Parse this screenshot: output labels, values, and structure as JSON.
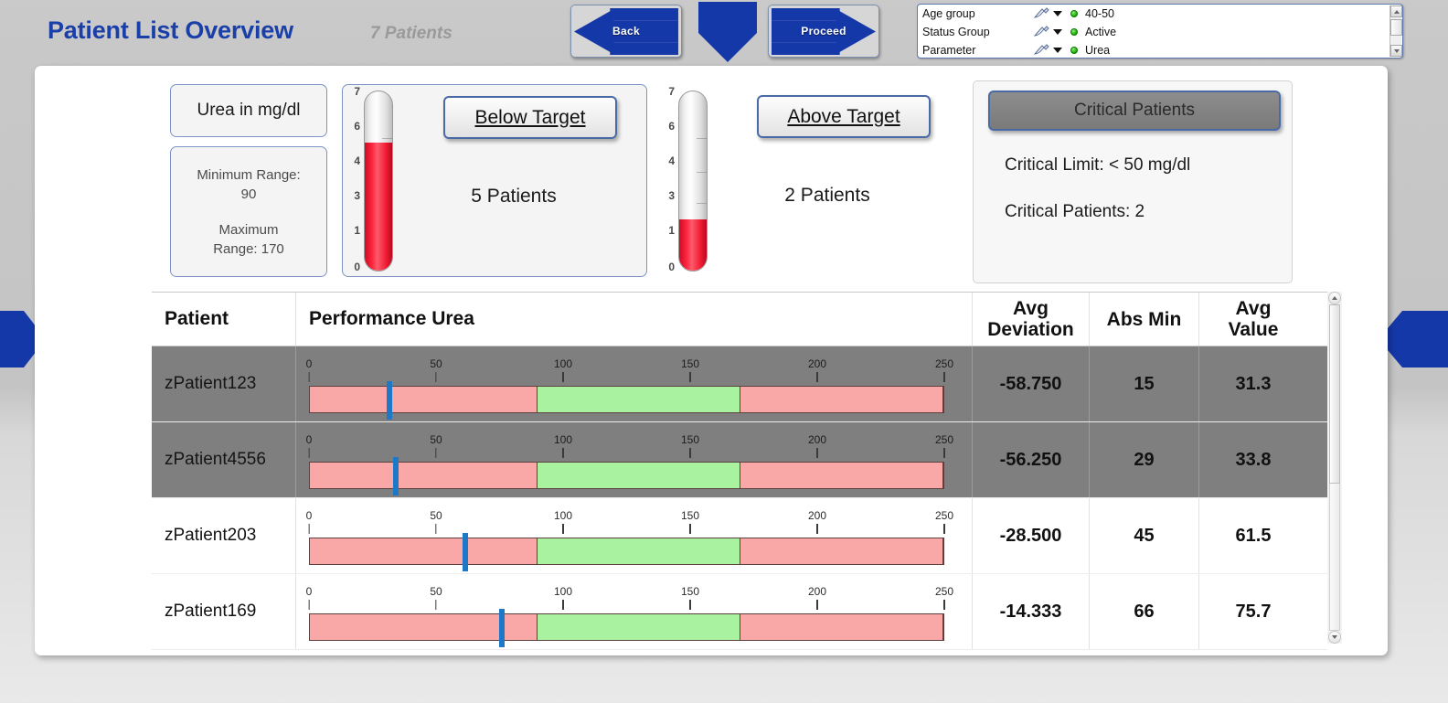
{
  "header": {
    "title": "Patient List Overview",
    "patient_count": "7 Patients",
    "back_button": "Back",
    "proceed_button": "Proceed"
  },
  "filters": {
    "rows": [
      {
        "label": "Age group",
        "icon": "pencil-icon",
        "value": "40-50",
        "status_color": "#18a800"
      },
      {
        "label": "Status Group",
        "icon": "pencil-icon",
        "value": "Active",
        "status_color": "#18a800"
      },
      {
        "label": "Parameter",
        "icon": "pencil-icon",
        "value": "Urea",
        "status_color": "#18a800"
      }
    ]
  },
  "summary": {
    "parameter_label": "Urea in mg/dl",
    "minimum_range_label": "Minimum Range:",
    "minimum_range_value": "90",
    "maximum_range_label": "Maximum",
    "maximum_range_value": "Range: 170",
    "below": {
      "button_label": "Below Target",
      "count_text": "5 Patients",
      "gauge_value": 5,
      "gauge_max": 7,
      "gauge_ticks": [
        "7",
        "6",
        "4",
        "3",
        "1",
        "0"
      ]
    },
    "above": {
      "button_label": "Above Target",
      "count_text": "2 Patients",
      "gauge_value": 2,
      "gauge_max": 7,
      "gauge_ticks": [
        "7",
        "6",
        "4",
        "3",
        "1",
        "0"
      ]
    },
    "critical": {
      "button_label": "Critical Patients",
      "limit_text": "Critical Limit: < 50 mg/dl",
      "count_text": "Critical Patients: 2"
    }
  },
  "table": {
    "columns": [
      "Patient",
      "Performance Urea",
      "Avg\nDeviation",
      "Abs Min",
      "Avg\nValue"
    ],
    "columns_display": {
      "patient": "Patient",
      "performance": "Performance Urea",
      "avg_deviation_l1": "Avg",
      "avg_deviation_l2": "Deviation",
      "abs_min": "Abs Min",
      "avg_value_l1": "Avg",
      "avg_value_l2": "Value"
    },
    "axis_ticks": [
      "0",
      "50",
      "100",
      "150",
      "200",
      "250"
    ],
    "axis_min": 0,
    "axis_max": 250,
    "zones": [
      {
        "from": 0,
        "to": 90,
        "color": "#f9a7a7"
      },
      {
        "from": 90,
        "to": 170,
        "color": "#a8f2a0"
      },
      {
        "from": 170,
        "to": 250,
        "color": "#f9a7a7"
      }
    ],
    "rows": [
      {
        "patient": "zPatient123",
        "avg_deviation": "-58.750",
        "abs_min": "15",
        "avg_value": "31.3",
        "marker": 31.3,
        "highlighted": true
      },
      {
        "patient": "zPatient4556",
        "avg_deviation": "-56.250",
        "abs_min": "29",
        "avg_value": "33.8",
        "marker": 33.8,
        "highlighted": true
      },
      {
        "patient": "zPatient203",
        "avg_deviation": "-28.500",
        "abs_min": "45",
        "avg_value": "61.5",
        "marker": 61.5,
        "highlighted": false
      },
      {
        "patient": "zPatient169",
        "avg_deviation": "-14.333",
        "abs_min": "66",
        "avg_value": "75.7",
        "marker": 75.7,
        "highlighted": false
      }
    ]
  },
  "nav": {
    "left_chevron": "left-page-chevron",
    "right_chevron": "right-page-chevron",
    "down_arrow": "down-arrow"
  },
  "colors": {
    "accent_blue": "#1b3fa8",
    "marker_blue": "#1d78c8",
    "zone_red": "#f9a7a7",
    "zone_green": "#a8f2a0",
    "row_highlight": "#7f7f7f"
  }
}
